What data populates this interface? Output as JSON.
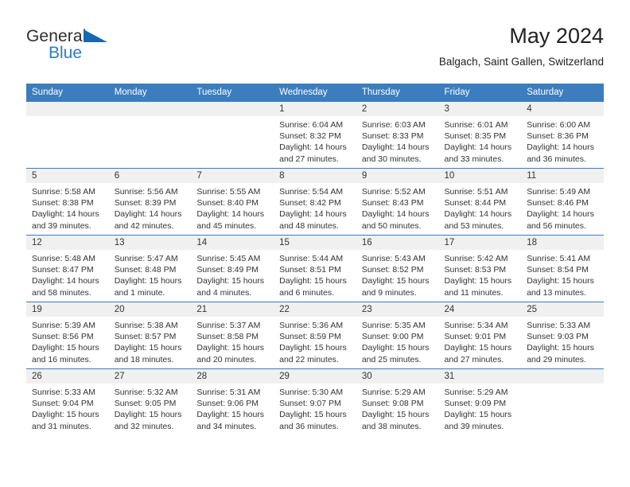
{
  "brand": {
    "name_part1": "General",
    "name_part2": "Blue",
    "triangle_color": "#1668b3",
    "blue_color": "#2e7cc4"
  },
  "header": {
    "month_title": "May 2024",
    "location": "Balgach, Saint Gallen, Switzerland"
  },
  "theme": {
    "header_blue": "#3b7dbf",
    "daynum_bg": "#f0f0f0"
  },
  "weekdays": [
    "Sunday",
    "Monday",
    "Tuesday",
    "Wednesday",
    "Thursday",
    "Friday",
    "Saturday"
  ],
  "weeks": [
    [
      {
        "day": "",
        "lines": []
      },
      {
        "day": "",
        "lines": []
      },
      {
        "day": "",
        "lines": []
      },
      {
        "day": "1",
        "lines": [
          "Sunrise: 6:04 AM",
          "Sunset: 8:32 PM",
          "Daylight: 14 hours",
          "and 27 minutes."
        ]
      },
      {
        "day": "2",
        "lines": [
          "Sunrise: 6:03 AM",
          "Sunset: 8:33 PM",
          "Daylight: 14 hours",
          "and 30 minutes."
        ]
      },
      {
        "day": "3",
        "lines": [
          "Sunrise: 6:01 AM",
          "Sunset: 8:35 PM",
          "Daylight: 14 hours",
          "and 33 minutes."
        ]
      },
      {
        "day": "4",
        "lines": [
          "Sunrise: 6:00 AM",
          "Sunset: 8:36 PM",
          "Daylight: 14 hours",
          "and 36 minutes."
        ]
      }
    ],
    [
      {
        "day": "5",
        "lines": [
          "Sunrise: 5:58 AM",
          "Sunset: 8:38 PM",
          "Daylight: 14 hours",
          "and 39 minutes."
        ]
      },
      {
        "day": "6",
        "lines": [
          "Sunrise: 5:56 AM",
          "Sunset: 8:39 PM",
          "Daylight: 14 hours",
          "and 42 minutes."
        ]
      },
      {
        "day": "7",
        "lines": [
          "Sunrise: 5:55 AM",
          "Sunset: 8:40 PM",
          "Daylight: 14 hours",
          "and 45 minutes."
        ]
      },
      {
        "day": "8",
        "lines": [
          "Sunrise: 5:54 AM",
          "Sunset: 8:42 PM",
          "Daylight: 14 hours",
          "and 48 minutes."
        ]
      },
      {
        "day": "9",
        "lines": [
          "Sunrise: 5:52 AM",
          "Sunset: 8:43 PM",
          "Daylight: 14 hours",
          "and 50 minutes."
        ]
      },
      {
        "day": "10",
        "lines": [
          "Sunrise: 5:51 AM",
          "Sunset: 8:44 PM",
          "Daylight: 14 hours",
          "and 53 minutes."
        ]
      },
      {
        "day": "11",
        "lines": [
          "Sunrise: 5:49 AM",
          "Sunset: 8:46 PM",
          "Daylight: 14 hours",
          "and 56 minutes."
        ]
      }
    ],
    [
      {
        "day": "12",
        "lines": [
          "Sunrise: 5:48 AM",
          "Sunset: 8:47 PM",
          "Daylight: 14 hours",
          "and 58 minutes."
        ]
      },
      {
        "day": "13",
        "lines": [
          "Sunrise: 5:47 AM",
          "Sunset: 8:48 PM",
          "Daylight: 15 hours",
          "and 1 minute."
        ]
      },
      {
        "day": "14",
        "lines": [
          "Sunrise: 5:45 AM",
          "Sunset: 8:49 PM",
          "Daylight: 15 hours",
          "and 4 minutes."
        ]
      },
      {
        "day": "15",
        "lines": [
          "Sunrise: 5:44 AM",
          "Sunset: 8:51 PM",
          "Daylight: 15 hours",
          "and 6 minutes."
        ]
      },
      {
        "day": "16",
        "lines": [
          "Sunrise: 5:43 AM",
          "Sunset: 8:52 PM",
          "Daylight: 15 hours",
          "and 9 minutes."
        ]
      },
      {
        "day": "17",
        "lines": [
          "Sunrise: 5:42 AM",
          "Sunset: 8:53 PM",
          "Daylight: 15 hours",
          "and 11 minutes."
        ]
      },
      {
        "day": "18",
        "lines": [
          "Sunrise: 5:41 AM",
          "Sunset: 8:54 PM",
          "Daylight: 15 hours",
          "and 13 minutes."
        ]
      }
    ],
    [
      {
        "day": "19",
        "lines": [
          "Sunrise: 5:39 AM",
          "Sunset: 8:56 PM",
          "Daylight: 15 hours",
          "and 16 minutes."
        ]
      },
      {
        "day": "20",
        "lines": [
          "Sunrise: 5:38 AM",
          "Sunset: 8:57 PM",
          "Daylight: 15 hours",
          "and 18 minutes."
        ]
      },
      {
        "day": "21",
        "lines": [
          "Sunrise: 5:37 AM",
          "Sunset: 8:58 PM",
          "Daylight: 15 hours",
          "and 20 minutes."
        ]
      },
      {
        "day": "22",
        "lines": [
          "Sunrise: 5:36 AM",
          "Sunset: 8:59 PM",
          "Daylight: 15 hours",
          "and 22 minutes."
        ]
      },
      {
        "day": "23",
        "lines": [
          "Sunrise: 5:35 AM",
          "Sunset: 9:00 PM",
          "Daylight: 15 hours",
          "and 25 minutes."
        ]
      },
      {
        "day": "24",
        "lines": [
          "Sunrise: 5:34 AM",
          "Sunset: 9:01 PM",
          "Daylight: 15 hours",
          "and 27 minutes."
        ]
      },
      {
        "day": "25",
        "lines": [
          "Sunrise: 5:33 AM",
          "Sunset: 9:03 PM",
          "Daylight: 15 hours",
          "and 29 minutes."
        ]
      }
    ],
    [
      {
        "day": "26",
        "lines": [
          "Sunrise: 5:33 AM",
          "Sunset: 9:04 PM",
          "Daylight: 15 hours",
          "and 31 minutes."
        ]
      },
      {
        "day": "27",
        "lines": [
          "Sunrise: 5:32 AM",
          "Sunset: 9:05 PM",
          "Daylight: 15 hours",
          "and 32 minutes."
        ]
      },
      {
        "day": "28",
        "lines": [
          "Sunrise: 5:31 AM",
          "Sunset: 9:06 PM",
          "Daylight: 15 hours",
          "and 34 minutes."
        ]
      },
      {
        "day": "29",
        "lines": [
          "Sunrise: 5:30 AM",
          "Sunset: 9:07 PM",
          "Daylight: 15 hours",
          "and 36 minutes."
        ]
      },
      {
        "day": "30",
        "lines": [
          "Sunrise: 5:29 AM",
          "Sunset: 9:08 PM",
          "Daylight: 15 hours",
          "and 38 minutes."
        ]
      },
      {
        "day": "31",
        "lines": [
          "Sunrise: 5:29 AM",
          "Sunset: 9:09 PM",
          "Daylight: 15 hours",
          "and 39 minutes."
        ]
      },
      {
        "day": "",
        "lines": []
      }
    ]
  ]
}
